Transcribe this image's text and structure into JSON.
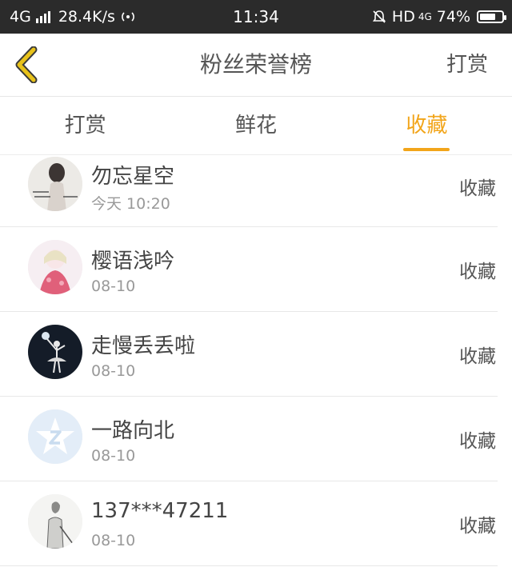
{
  "status_bar": {
    "network": "4G",
    "speed": "28.4K/s",
    "time": "11:34",
    "hd": "HD",
    "net2": "4G",
    "battery": "74%",
    "battery_level": 0.74
  },
  "header": {
    "title": "粉丝荣誉榜",
    "action": "打赏"
  },
  "tabs": [
    {
      "label": "打赏",
      "active": false
    },
    {
      "label": "鲜花",
      "active": false
    },
    {
      "label": "收藏",
      "active": true
    }
  ],
  "list": [
    {
      "name": "勿忘星空",
      "date": "今天 10:20",
      "action": "收藏",
      "avatar": "girl-photo-avatar"
    },
    {
      "name": "樱语浅吟",
      "date": "08-10",
      "action": "收藏",
      "avatar": "anime-girl-avatar"
    },
    {
      "name": "走慢丢丢啦",
      "date": "08-10",
      "action": "收藏",
      "avatar": "dancer-avatar"
    },
    {
      "name": "一路向北",
      "date": "08-10",
      "action": "收藏",
      "avatar": "default-star-avatar"
    },
    {
      "name": "137***47211",
      "date": "08-10",
      "action": "收藏",
      "avatar": "sketch-figure-avatar"
    }
  ],
  "colors": {
    "accent": "#f2a51a",
    "status_bar": "#2b2b2b",
    "back_arrow": "#e8c21a"
  }
}
